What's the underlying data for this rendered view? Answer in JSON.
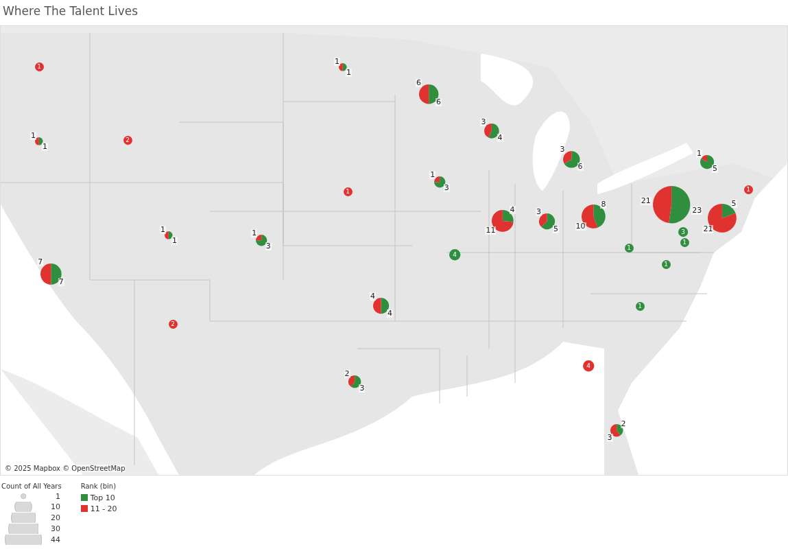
{
  "title": "Where The Talent Lives",
  "map": {
    "attribution": "© 2025 Mapbox © OpenStreetMap",
    "marks": [
      {
        "rank_11_20": "1"
      },
      {
        "top_10": "1",
        "rank_11_20": "1"
      },
      {
        "rank_11_20": "2"
      },
      {
        "top_10": "7",
        "rank_11_20": "7"
      },
      {
        "top_10": "1",
        "rank_11_20": "1"
      },
      {
        "top_10": "3",
        "rank_11_20": "1"
      },
      {
        "rank_11_20": "2"
      },
      {
        "top_10": "1",
        "rank_11_20": "1"
      },
      {
        "top_10": "6",
        "rank_11_20": "6"
      },
      {
        "top_10": "4",
        "rank_11_20": "3"
      },
      {
        "rank_11_20": "1"
      },
      {
        "top_10": "3",
        "rank_11_20": "1"
      },
      {
        "top_10": "4",
        "rank_11_20": "11"
      },
      {
        "top_10": "5",
        "rank_11_20": "3"
      },
      {
        "top_10": "4"
      },
      {
        "top_10": "4",
        "rank_11_20": "4"
      },
      {
        "top_10": "3",
        "rank_11_20": "2"
      },
      {
        "top_10": "6",
        "rank_11_20": "3"
      },
      {
        "top_10": "8",
        "rank_11_20": "10"
      },
      {
        "top_10": "23",
        "rank_11_20": "21"
      },
      {
        "top_10": "5",
        "rank_11_20": "1"
      },
      {
        "top_10": "5",
        "rank_11_20": "21"
      },
      {
        "top_10": "3"
      },
      {
        "top_10": "1"
      },
      {
        "top_10": "1"
      },
      {
        "top_10": "1"
      },
      {
        "top_10": "1"
      },
      {
        "rank_11_20": "1"
      },
      {
        "rank_11_20": "4"
      },
      {
        "top_10": "2",
        "rank_11_20": "3"
      }
    ]
  },
  "size_legend": {
    "title": "Count of All Years",
    "items": [
      "1",
      "10",
      "20",
      "30",
      "44"
    ]
  },
  "color_legend": {
    "title": "Rank (bin)",
    "items": [
      {
        "label": "Top 10",
        "color": "#2f8f3f"
      },
      {
        "label": "11 - 20",
        "color": "#e0322f"
      }
    ]
  }
}
